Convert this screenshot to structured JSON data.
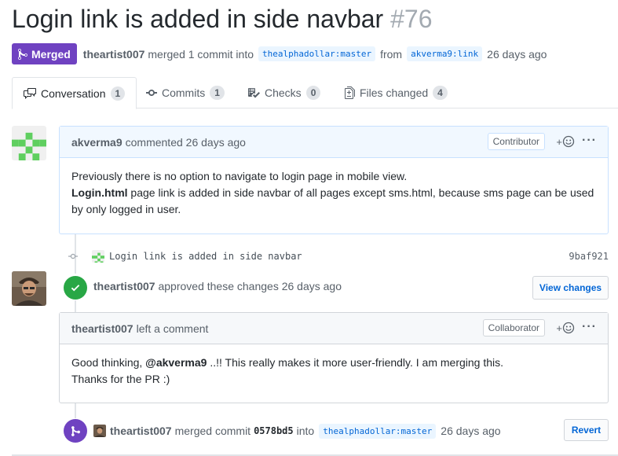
{
  "pr": {
    "title": "Login link is added in side navbar",
    "number": "#76",
    "status": "Merged",
    "author": "theartist007",
    "merge_text": "merged 1 commit into",
    "base_branch": "thealphadollar:master",
    "from_text": "from",
    "head_branch": "akverma9:link",
    "time": "26 days ago"
  },
  "tabs": [
    {
      "label": "Conversation",
      "count": "1",
      "icon": "comment-discussion-icon"
    },
    {
      "label": "Commits",
      "count": "1",
      "icon": "git-commit-icon"
    },
    {
      "label": "Checks",
      "count": "0",
      "icon": "checklist-icon"
    },
    {
      "label": "Files changed",
      "count": "4",
      "icon": "file-diff-icon"
    }
  ],
  "comment1": {
    "author": "akverma9",
    "action": "commented 26 days ago",
    "role": "Contributor",
    "line1": "Previously there is no option to navigate to login page in mobile view.",
    "line2_bold": "Login.html",
    "line2_rest": " page link is added in side navbar of all pages except sms.html, because sms page can be used by only logged in user."
  },
  "commit": {
    "message": "Login link is added in side navbar",
    "sha": "9baf921"
  },
  "review": {
    "author": "theartist007",
    "action": "approved these changes 26 days ago",
    "view_button": "View changes"
  },
  "comment2": {
    "author": "theartist007",
    "action": "left a comment",
    "role": "Collaborator",
    "pre": "Good thinking, ",
    "mention": "@akverma9",
    "post": " ..!! This really makes it more user-friendly. I am merging this.",
    "line2": "Thanks for the PR :)"
  },
  "merge_event": {
    "author": "theartist007",
    "text1": "merged commit",
    "sha": "0578bd5",
    "text2": "into",
    "branch": "thealphadollar:master",
    "time": "26 days ago",
    "revert_button": "Revert"
  },
  "colors": {
    "merged_purple": "#6f42c1",
    "approved_green": "#28a745",
    "link_blue": "#0366d6",
    "identicon_green": "#5fcf5f"
  }
}
